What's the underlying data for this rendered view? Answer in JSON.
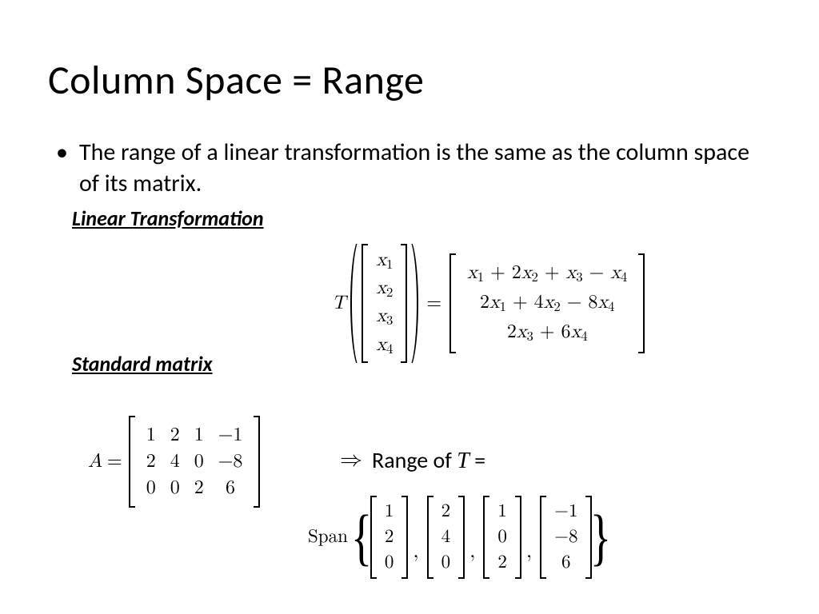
{
  "title": "Column Space = Range",
  "bullet1": "The range of a linear transformation is the same as the column space of its matrix.",
  "sub_linear": "Linear Transformation",
  "sub_standard": "Standard matrix",
  "T_label": "T",
  "A_label": "A",
  "eq": "=",
  "implies": "⇒",
  "range_of": "Range of ",
  "T_ital": "T",
  "range_eq": " =",
  "span_label": "Span",
  "x_vec": [
    "x1",
    "x2",
    "x3",
    "x4"
  ],
  "rhs_lines": [
    "x1 + 2x2 + x3 − x4",
    "2x1 + 4x2 − 8x4",
    "2x3 + 6x4"
  ],
  "A_rows": [
    [
      "1",
      "2",
      "1",
      "−1"
    ],
    [
      "2",
      "4",
      "0",
      "−8"
    ],
    [
      "0",
      "0",
      "2",
      "6"
    ]
  ],
  "span_vecs": [
    [
      "1",
      "2",
      "0"
    ],
    [
      "2",
      "4",
      "0"
    ],
    [
      "1",
      "0",
      "2"
    ],
    [
      "−1",
      "−8",
      "6"
    ]
  ],
  "chart_data": {
    "type": "table",
    "title": "Column Space = Range — slide content",
    "transformation_input": [
      "x1",
      "x2",
      "x3",
      "x4"
    ],
    "transformation_output": [
      "x1 + 2x2 + x3 - x4",
      "2x1 + 4x2 - 8x4",
      "2x3 + 6x4"
    ],
    "standard_matrix_A": [
      [
        1,
        2,
        1,
        -1
      ],
      [
        2,
        4,
        0,
        -8
      ],
      [
        0,
        0,
        2,
        6
      ]
    ],
    "range_span_columns": [
      [
        1,
        2,
        0
      ],
      [
        2,
        4,
        0
      ],
      [
        1,
        0,
        2
      ],
      [
        -1,
        -8,
        6
      ]
    ]
  }
}
